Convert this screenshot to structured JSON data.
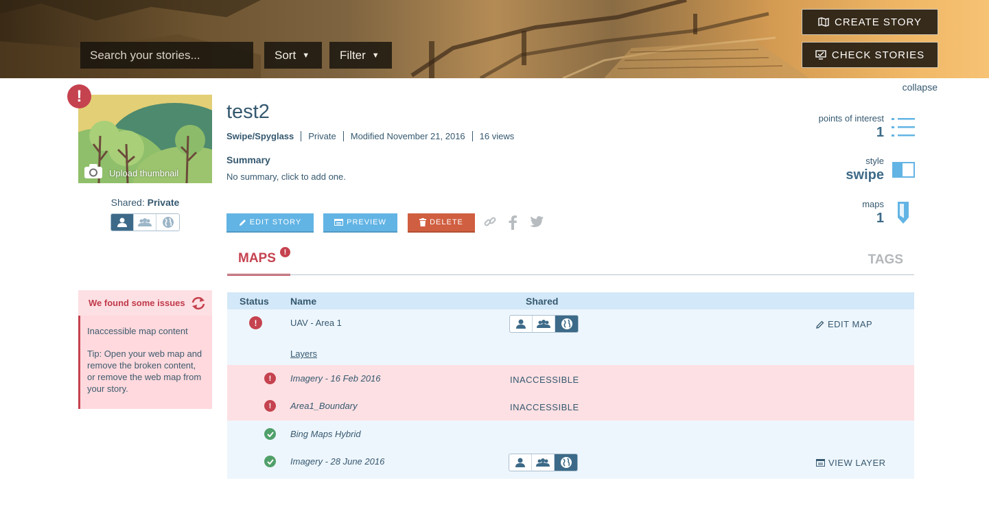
{
  "header": {
    "search_placeholder": "Search your stories...",
    "sort_label": "Sort",
    "filter_label": "Filter",
    "create_story_label": "CREATE STORY",
    "check_stories_label": "CHECK STORIES"
  },
  "thumbnail": {
    "upload_label": "Upload thumbnail",
    "issue_badge": "!"
  },
  "sharing": {
    "shared_prefix": "Shared:",
    "shared_value": "Private",
    "options": [
      "private",
      "organization",
      "public"
    ],
    "selected": "private"
  },
  "issues_panel": {
    "title": "We found some issues",
    "message": "Inaccessible map content",
    "tip": "Tip: Open your web map and remove the broken content, or remove the web map from your story."
  },
  "story": {
    "title": "test2",
    "type": "Swipe/Spyglass",
    "access": "Private",
    "modified": "Modified November 21, 2016",
    "views": "16 views",
    "summary_label": "Summary",
    "summary_text": "No summary, click to add one."
  },
  "actions": {
    "edit_label": "EDIT STORY",
    "preview_label": "PREVIEW",
    "delete_label": "DELETE"
  },
  "stats": {
    "collapse_label": "collapse",
    "poi_label": "points of interest",
    "poi_value": "1",
    "style_label": "style",
    "style_value": "swipe",
    "maps_label": "maps",
    "maps_value": "1"
  },
  "tabs": {
    "maps_label": "MAPS",
    "maps_alert": "!",
    "tags_label": "TAGS"
  },
  "table": {
    "headers": {
      "status": "Status",
      "name": "Name",
      "shared": "Shared"
    },
    "map": {
      "name": "UAV - Area 1",
      "status": "error",
      "shared": "public",
      "action_label": "EDIT MAP",
      "layers_label": "Layers"
    },
    "layers": [
      {
        "name": "Imagery - 16 Feb 2016",
        "status": "error",
        "shared_text": "INACCESSIBLE"
      },
      {
        "name": "Area1_Boundary",
        "status": "error",
        "shared_text": "INACCESSIBLE"
      },
      {
        "name": "Bing Maps Hybrid",
        "status": "ok",
        "shared_text": ""
      },
      {
        "name": "Imagery - 28 June 2016",
        "status": "ok",
        "shared": "public",
        "action_label": "VIEW LAYER"
      }
    ]
  },
  "colors": {
    "primary_text": "#35586f",
    "accent_blue": "#62b4e4",
    "danger": "#c5424f",
    "delete_button": "#d05e40",
    "success": "#51a06a",
    "error_row": "#fde0e3",
    "info_row": "#eef6fd",
    "table_header": "#d3e8f8"
  }
}
